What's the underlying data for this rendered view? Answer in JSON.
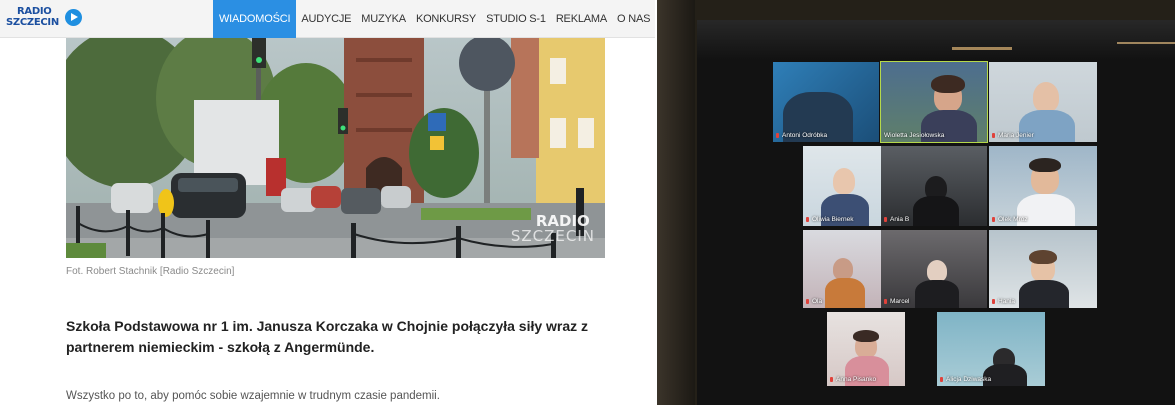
{
  "site": {
    "logo": {
      "line1": "RADIO",
      "line2": "SZCZECIN"
    },
    "nav": [
      {
        "label": "WIADOMOŚCI",
        "active": true
      },
      {
        "label": "AUDYCJE",
        "active": false
      },
      {
        "label": "MUZYKA",
        "active": false
      },
      {
        "label": "KONKURSY",
        "active": false
      },
      {
        "label": "STUDIO S-1",
        "active": false
      },
      {
        "label": "REKLAMA",
        "active": false
      },
      {
        "label": "O NAS",
        "active": false
      }
    ],
    "photo": {
      "watermark_line1": "RADIO",
      "watermark_line2": "SZCZECIN"
    },
    "caption": "Fot. Robert Stachnik [Radio Szczecin]",
    "lead": "Szkoła Podstawowa nr 1 im. Janusza Korczaka w Chojnie połączyła siły wraz z partnerem niemieckim - szkołą z Angermünde.",
    "body": "Wszystko po to, aby pomóc sobie wzajemnie w trudnym czasie pandemii.",
    "colors": {
      "accent": "#2b8fe3",
      "logo": "#1b4fa0"
    }
  },
  "video_call": {
    "participants": [
      {
        "name": "Antoni Odróbka",
        "speaking": false
      },
      {
        "name": "Wioletta Jesiołowska",
        "speaking": true
      },
      {
        "name": "Maria Jenier",
        "speaking": false
      },
      {
        "name": "Oliwia Biernek",
        "speaking": false
      },
      {
        "name": "Ania B",
        "speaking": false
      },
      {
        "name": "Olek Mróz",
        "speaking": false
      },
      {
        "name": "Ola",
        "speaking": false
      },
      {
        "name": "Marcel",
        "speaking": false
      },
      {
        "name": "Hania",
        "speaking": false
      },
      {
        "name": "Anna Pisanko",
        "speaking": false
      },
      {
        "name": "Alicja Dziwaska",
        "speaking": false
      }
    ],
    "colors": {
      "speaking_border": "#b6d94a",
      "muted_mic": "#e0413a"
    }
  }
}
